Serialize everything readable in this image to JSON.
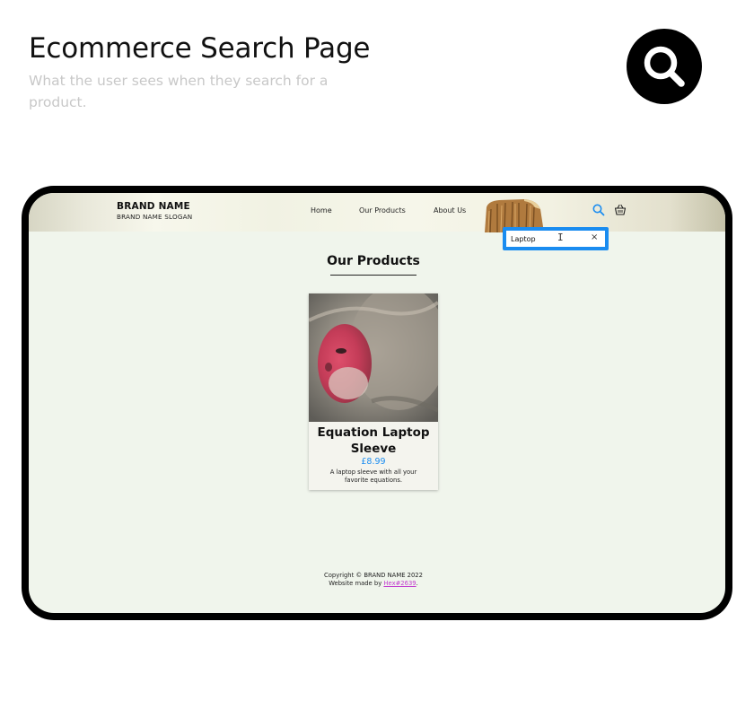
{
  "page": {
    "title": "Ecommerce Search Page",
    "subtitle": "What the user sees when they search for a product."
  },
  "icons": {
    "badge": "search-icon",
    "header_search": "search-icon",
    "header_cart": "basket-icon"
  },
  "colors": {
    "accent": "#1a8cf0",
    "link": "#c23ccf",
    "screen_bg": "#f0f5ec",
    "badge_bg": "#000000"
  },
  "site": {
    "brand_name": "BRAND NAME",
    "brand_slogan": "BRAND NAME SLOGAN",
    "nav": {
      "home": "Home",
      "products": "Our Products",
      "about": "About Us"
    },
    "search": {
      "value": "Laptop",
      "clear_label": "×"
    },
    "main": {
      "heading": "Our Products",
      "products": [
        {
          "name": "Equation Laptop Sleeve",
          "price": "£8.99",
          "description": "A laptop sleeve with all your favorite equations."
        }
      ]
    },
    "footer": {
      "copyright": "Copyright © BRAND NAME 2022",
      "made_by_prefix": "Website made by ",
      "made_by_link": "Hex#2639",
      "made_by_suffix": "."
    }
  }
}
